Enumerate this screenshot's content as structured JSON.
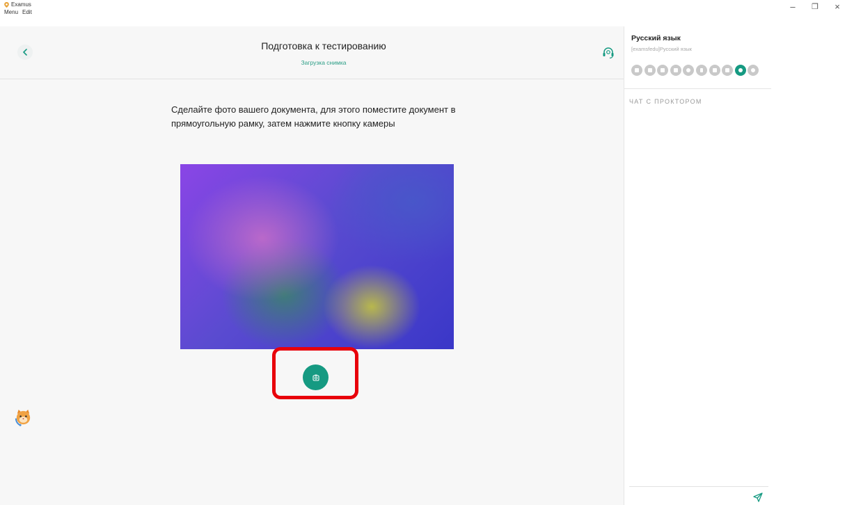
{
  "window": {
    "title": "Examus",
    "menu": [
      "Menu",
      "Edit"
    ],
    "controls": {
      "minimize": "–",
      "maximize": "❐",
      "close": "×"
    }
  },
  "header": {
    "title": "Подготовка к тестированию",
    "subtitle": "Загрузка снимка",
    "back_icon": "chevron-left-icon",
    "support_icon": "headset-icon"
  },
  "main": {
    "instructions": "Сделайте фото вашего документа, для этого поместите документ в прямоугольную рамку, затем нажмите кнопку камеры",
    "capture_icon": "camera-icon",
    "highlight_color": "#e8000b"
  },
  "sidebar": {
    "exam_title": "Русский язык",
    "exam_subtitle": "[examsfedu]Русский язык",
    "status_icons": [
      {
        "icon": "mic-icon",
        "active": false
      },
      {
        "icon": "book-icon",
        "active": false
      },
      {
        "icon": "calculator-icon",
        "active": false
      },
      {
        "icon": "calculator-icon",
        "active": false
      },
      {
        "icon": "globe-icon",
        "active": false
      },
      {
        "icon": "phone-icon",
        "active": false
      },
      {
        "icon": "document-icon",
        "active": false
      },
      {
        "icon": "screen-icon",
        "active": false
      },
      {
        "icon": "eye-icon",
        "active": true
      },
      {
        "icon": "person-icon",
        "active": false
      }
    ],
    "chat_header": "ЧАТ С ПРОКТОРОМ",
    "send_icon": "send-icon"
  },
  "colors": {
    "accent": "#169a82",
    "subtitle": "#2a9d85",
    "panel_bg": "#f7f7f7"
  }
}
